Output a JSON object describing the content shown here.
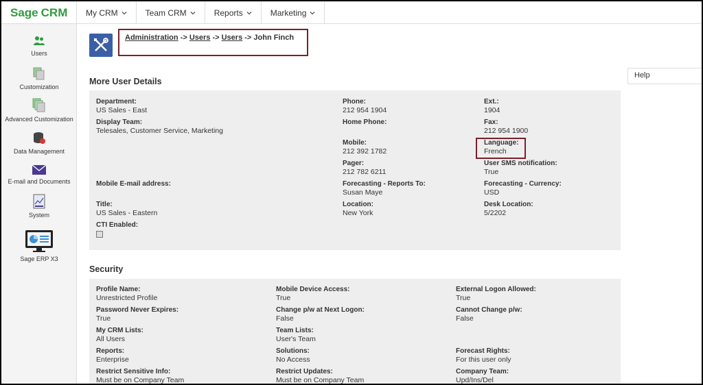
{
  "app": {
    "logo_sage": "Sage",
    "logo_crm": "CRM"
  },
  "topnav": [
    {
      "label": "My CRM"
    },
    {
      "label": "Team CRM"
    },
    {
      "label": "Reports"
    },
    {
      "label": "Marketing"
    }
  ],
  "sidebar": [
    {
      "label": "Users",
      "icon": "users-icon"
    },
    {
      "label": "Customization",
      "icon": "customization-icon"
    },
    {
      "label": "Advanced Customization",
      "icon": "advanced-customization-icon"
    },
    {
      "label": "Data Management",
      "icon": "database-icon"
    },
    {
      "label": "E-mail and Documents",
      "icon": "envelope-icon"
    },
    {
      "label": "System",
      "icon": "system-icon"
    },
    {
      "label": "Sage ERP X3",
      "icon": "monitor-icon"
    }
  ],
  "breadcrumb": {
    "admin": "Administration",
    "sep": " -> ",
    "users1": "Users",
    "users2": "Users",
    "current": "John Finch"
  },
  "help": "Help",
  "details": {
    "title": "More User Details",
    "fields": {
      "department": {
        "label": "Department:",
        "value": "US Sales - East"
      },
      "phone": {
        "label": "Phone:",
        "value": "212 954 1904"
      },
      "ext": {
        "label": "Ext.:",
        "value": "1904"
      },
      "display_team": {
        "label": "Display Team:",
        "value": "Telesales, Customer Service, Marketing"
      },
      "home_phone": {
        "label": "Home Phone:",
        "value": ""
      },
      "fax": {
        "label": "Fax:",
        "value": "212 954 1900"
      },
      "mobile": {
        "label": "Mobile:",
        "value": "212 392 1782"
      },
      "language": {
        "label": "Language:",
        "value": "French"
      },
      "pager": {
        "label": "Pager:",
        "value": "212 782 6211"
      },
      "sms": {
        "label": "User SMS notification:",
        "value": "True"
      },
      "mobile_email": {
        "label": "Mobile E-mail address:",
        "value": ""
      },
      "forecast_reports": {
        "label": "Forecasting - Reports To:",
        "value": "Susan Maye"
      },
      "forecast_currency": {
        "label": "Forecasting - Currency:",
        "value": "USD"
      },
      "title": {
        "label": "Title:",
        "value": "US Sales - Eastern"
      },
      "location": {
        "label": "Location:",
        "value": "New York"
      },
      "desk": {
        "label": "Desk Location:",
        "value": "5/2202"
      },
      "cti": {
        "label": "CTI Enabled:",
        "value": ""
      }
    }
  },
  "security": {
    "title": "Security",
    "fields": {
      "profile": {
        "label": "Profile Name:",
        "value": "Unrestricted Profile"
      },
      "mobile_access": {
        "label": "Mobile Device Access:",
        "value": "True"
      },
      "ext_logon": {
        "label": "External Logon Allowed:",
        "value": "True"
      },
      "pw_expires": {
        "label": "Password Never Expires:",
        "value": "True"
      },
      "change_pw": {
        "label": "Change p/w at Next Logon:",
        "value": "False"
      },
      "cannot_change": {
        "label": "Cannot Change p/w:",
        "value": "False"
      },
      "crm_lists": {
        "label": "My CRM Lists:",
        "value": "All Users"
      },
      "team_lists": {
        "label": "Team Lists:",
        "value": "User's Team"
      },
      "reports": {
        "label": "Reports:",
        "value": "Enterprise"
      },
      "solutions": {
        "label": "Solutions:",
        "value": "No Access"
      },
      "forecast_rights": {
        "label": "Forecast Rights:",
        "value": "For this user only"
      },
      "restrict_sensitive": {
        "label": "Restrict Sensitive Info:",
        "value": "Must be on Company Team"
      },
      "restrict_updates": {
        "label": "Restrict Updates:",
        "value": "Must be on Company Team"
      },
      "company_team": {
        "label": "Company Team:",
        "value": "Upd/Ins/Del"
      }
    }
  },
  "colors": {
    "brand_green": "#2e9b3f",
    "highlight_box": "#7a1f2b",
    "icon_blue": "#3b5fa6"
  }
}
